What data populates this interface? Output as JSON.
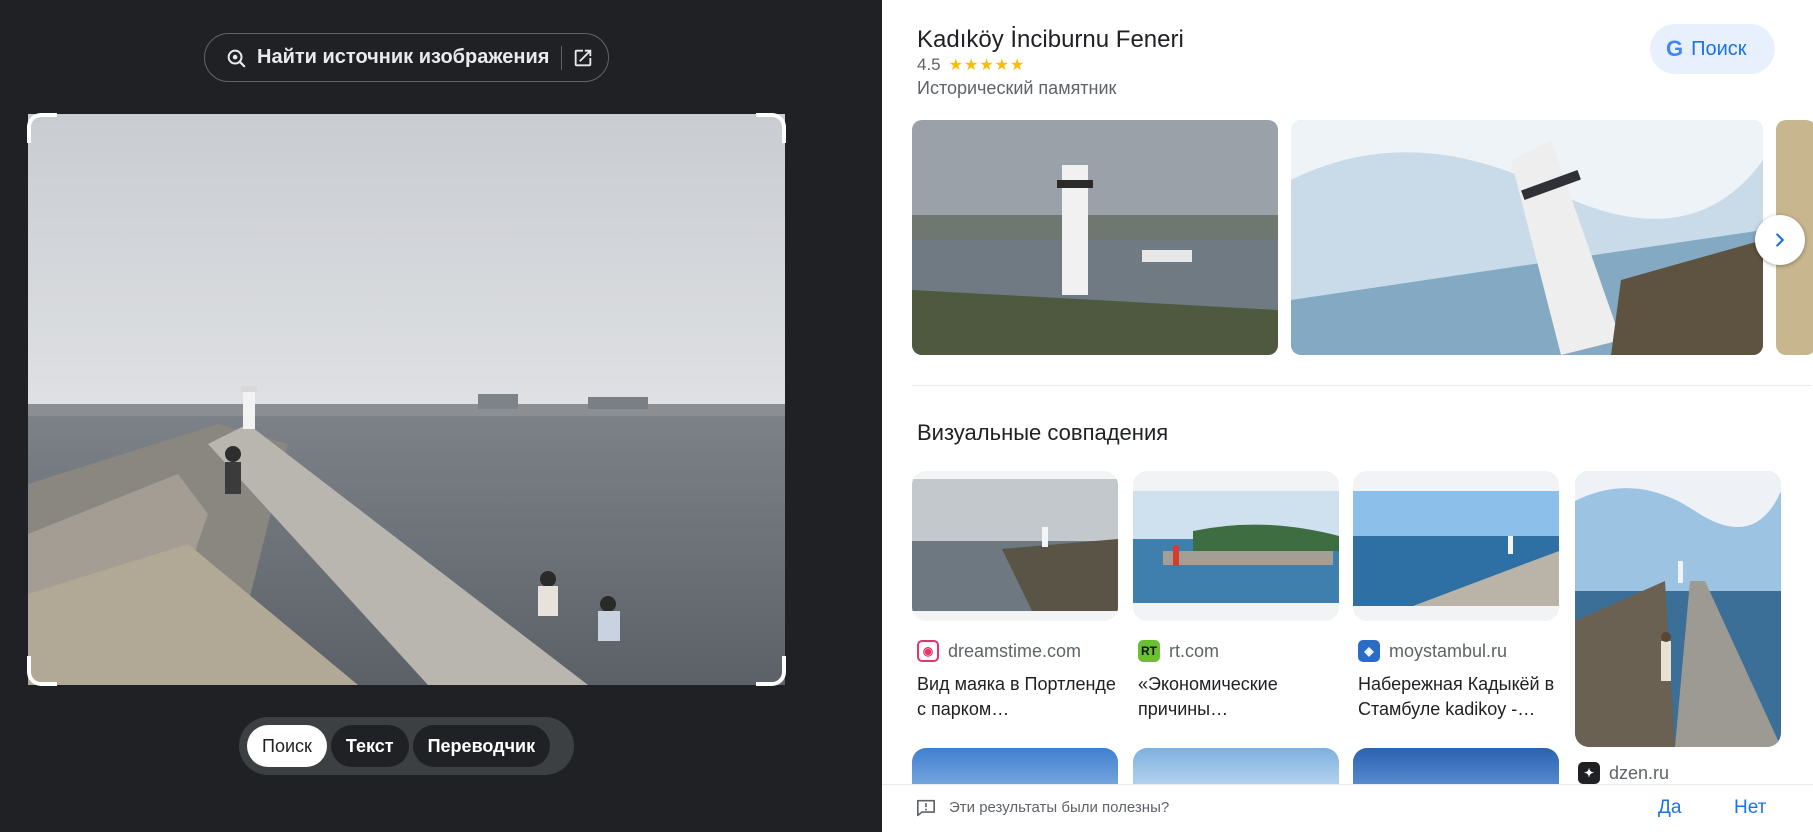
{
  "left_panel": {
    "find_source_label": "Найти источник изображения",
    "modes": [
      "Поиск",
      "Текст",
      "Переводчик"
    ],
    "active_mode": "Поиск"
  },
  "knowledge": {
    "title": "Kadıköy İnciburnu Feneri",
    "rating": "4.5",
    "stars": "★★★★★",
    "type": "Исторический памятник",
    "search_button": "Поиск",
    "next_icon": "chevron-right-icon"
  },
  "visual_matches": {
    "title": "Визуальные совпадения",
    "cards": [
      {
        "source": "dreamstime.com",
        "caption": "Вид маяка в Портленде с парком…",
        "favicon_color": "#e8336a"
      },
      {
        "source": "rt.com",
        "caption": "«Экономические причины…",
        "favicon_color": "#6cbe32"
      },
      {
        "source": "moystambul.ru",
        "caption": "Набережная Кадыкёй в Стамбуле kadikoy -…",
        "favicon_color": "#2b6cc4"
      },
      {
        "source": "dzen.ru",
        "caption": "",
        "favicon_color": "#202124"
      }
    ]
  },
  "feedback": {
    "question": "Эти результаты были полезны?",
    "yes": "Да",
    "no": "Нет"
  },
  "colors": {
    "left_bg": "#202124",
    "accent": "#1a73e8",
    "star": "#fbbc04"
  }
}
